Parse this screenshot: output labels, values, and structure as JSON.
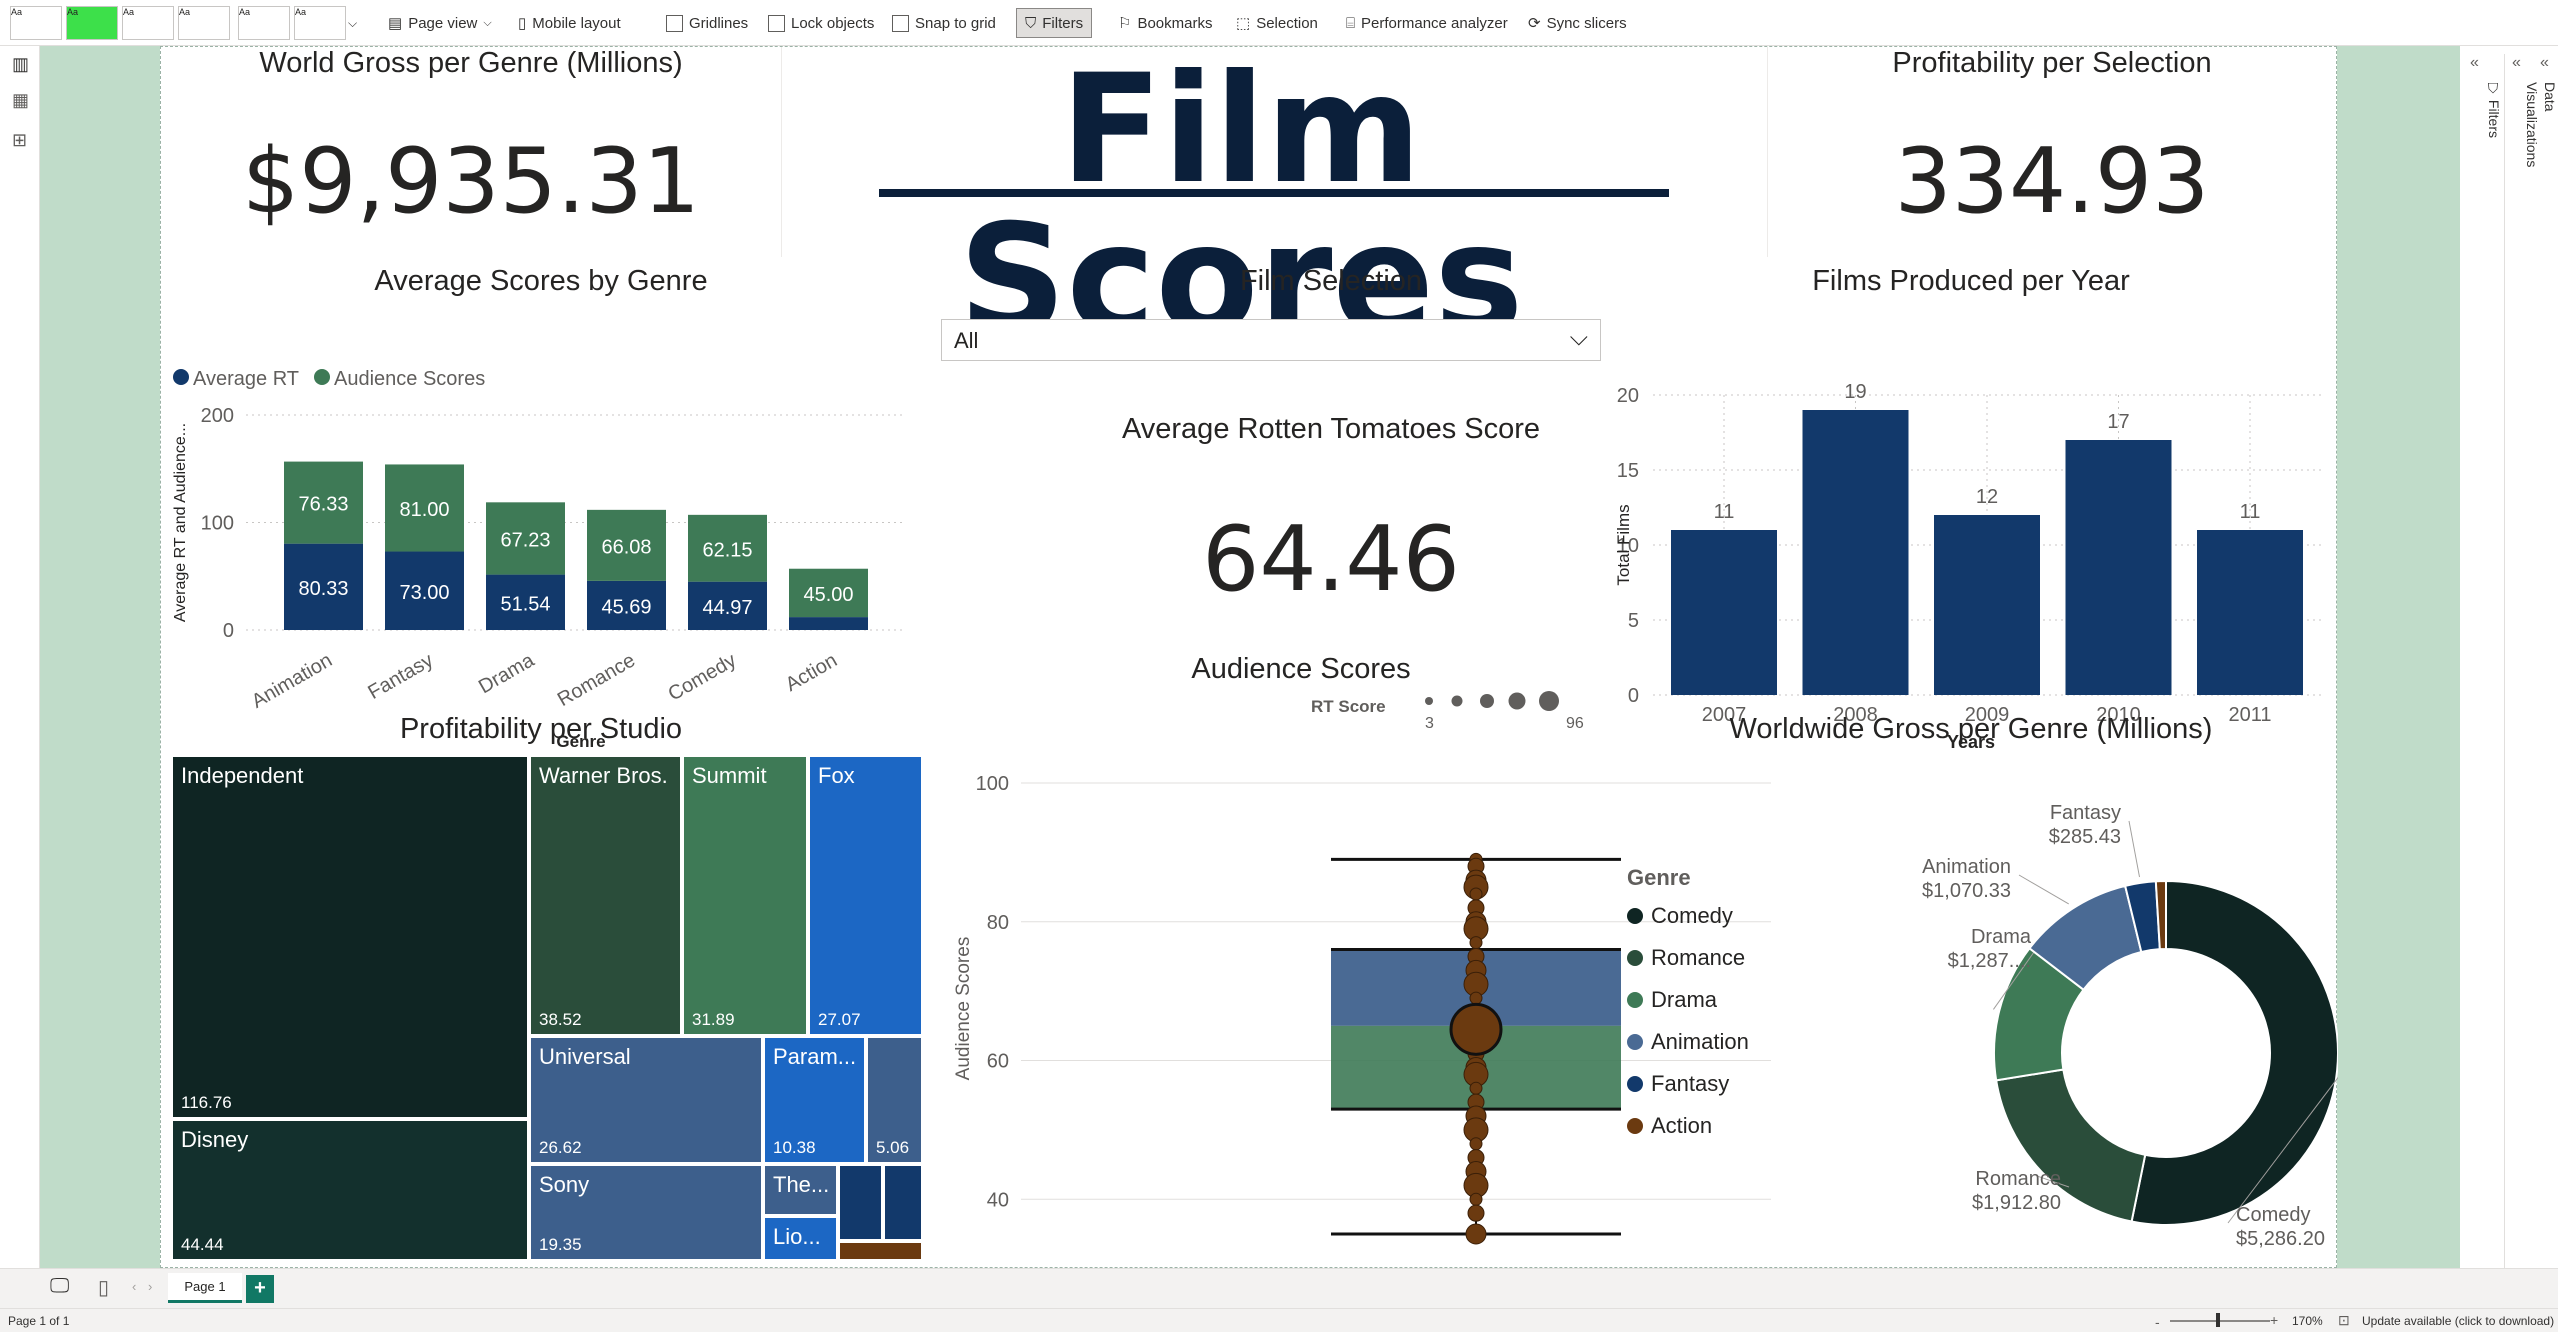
{
  "ribbon": {
    "page_view": "Page view",
    "mobile_layout": "Mobile layout",
    "gridlines": "Gridlines",
    "lock_objects": "Lock objects",
    "snap_to_grid": "Snap to grid",
    "filters": "Filters",
    "bookmarks": "Bookmarks",
    "selection": "Selection",
    "performance_analyzer": "Performance analyzer",
    "sync_slicers": "Sync slicers",
    "theme_label": "Aa"
  },
  "panes": {
    "filters": "Filters",
    "visualizations": "Visualizations",
    "data": "Data"
  },
  "report": {
    "title": "Film Scores",
    "world_gross": {
      "title": "World Gross per Genre (Millions)",
      "value": "$9,935.31"
    },
    "profitability": {
      "title": "Profitability per Selection",
      "value": "334.93"
    },
    "avg_rt": {
      "title": "Average Rotten Tomatoes Score",
      "value": "64.46"
    },
    "slicer": {
      "title": "Film Selection",
      "value": "All"
    }
  },
  "chart_data": [
    {
      "type": "bar",
      "stacked": true,
      "title": "Average Scores by Genre",
      "xlabel": "Genre",
      "ylabel": "Average RT and Audience...",
      "ylim": [
        0,
        200
      ],
      "yticks": [
        "0",
        "100",
        "200"
      ],
      "categories": [
        "Animation",
        "Fantasy",
        "Drama",
        "Romance",
        "Comedy",
        "Action"
      ],
      "series": [
        {
          "name": "Average RT",
          "color": "#12396b",
          "values": [
            80.33,
            73.0,
            51.54,
            45.69,
            44.97,
            12.0
          ],
          "labels": [
            "80.33",
            "73.00",
            "51.54",
            "45.69",
            "44.97",
            ""
          ]
        },
        {
          "name": "Audience Scores",
          "color": "#3e7a56",
          "values": [
            76.33,
            81.0,
            67.23,
            66.08,
            62.15,
            45.0
          ],
          "labels": [
            "76.33",
            "81.00",
            "67.23",
            "66.08",
            "62.15",
            "45.00"
          ]
        }
      ],
      "legend": "top-left"
    },
    {
      "type": "bar",
      "title": "Films Produced per Year",
      "xlabel": "Years",
      "ylabel": "Total Films",
      "ylim": [
        0,
        20
      ],
      "yticks": [
        "0",
        "5",
        "10",
        "15",
        "20"
      ],
      "categories": [
        "2007",
        "2008",
        "2009",
        "2010",
        "2011"
      ],
      "values": [
        11,
        19,
        12,
        17,
        11
      ],
      "color": "#12396b"
    },
    {
      "type": "table",
      "title": "Profitability per Studio",
      "cells": [
        {
          "name": "Independent",
          "value": "116.76",
          "color": "#0f2523"
        },
        {
          "name": "Disney",
          "value": "44.44",
          "color": "#13302d"
        },
        {
          "name": "Warner Bros.",
          "value": "38.52",
          "color": "#2a4d3a"
        },
        {
          "name": "Summit",
          "value": "31.89",
          "color": "#3e7a56"
        },
        {
          "name": "Fox",
          "value": "27.07",
          "color": "#1c67c4"
        },
        {
          "name": "Universal",
          "value": "26.62",
          "color": "#3d5f8c"
        },
        {
          "name": "Sony",
          "value": "19.35",
          "color": "#3d5f8c"
        },
        {
          "name": "Param...",
          "value": "10.38",
          "color": "#1c67c4"
        },
        {
          "name": "",
          "value": "5.06",
          "color": "#3d5f8c"
        },
        {
          "name": "The...",
          "value": "",
          "color": "#3d5f8c"
        },
        {
          "name": "Lio...",
          "value": "",
          "color": "#1c67c4"
        },
        {
          "name": "",
          "value": "",
          "color": "#12396b"
        },
        {
          "name": "",
          "value": "",
          "color": "#12396b"
        },
        {
          "name": "",
          "value": "",
          "color": "#6b3a10"
        }
      ]
    },
    {
      "type": "scatter",
      "title": "Audience Scores",
      "ylabel": "Audience Scores",
      "ylim": [
        35,
        100
      ],
      "yticks": [
        "40",
        "60",
        "80",
        "100"
      ],
      "size_legend": {
        "label": "RT Score",
        "min": "3",
        "max": "96"
      },
      "box": {
        "whisker_high": 89,
        "q3": 76,
        "median": 65,
        "q1": 53,
        "whisker_low": 35,
        "mean": 64.5
      },
      "points": [
        89,
        88,
        86,
        85,
        84,
        82,
        80,
        79,
        77,
        75,
        73,
        71,
        69,
        67,
        66,
        64,
        62,
        61,
        59,
        58,
        56,
        54,
        52,
        50,
        48,
        46,
        44,
        42,
        40,
        38,
        35
      ],
      "color": "#6b3a10"
    },
    {
      "type": "pie",
      "donut": true,
      "title": "Worldwide Gross per Genre (Millions)",
      "legend_title": "Genre",
      "slices": [
        {
          "name": "Comedy",
          "value": 5286.2,
          "label": "$5,286.20",
          "color": "#0f2523"
        },
        {
          "name": "Romance",
          "value": 1912.8,
          "label": "$1,912.80",
          "color": "#2a4d3a"
        },
        {
          "name": "Drama",
          "value": 1287.0,
          "label": "$1,287....",
          "color": "#3e7a56"
        },
        {
          "name": "Animation",
          "value": 1070.33,
          "label": "$1,070.33",
          "color": "#4a6a94"
        },
        {
          "name": "Fantasy",
          "value": 285.43,
          "label": "$285.43",
          "color": "#12396b"
        },
        {
          "name": "Action",
          "value": 93.55,
          "label": "",
          "color": "#6b3a10"
        }
      ],
      "legend": "left"
    }
  ],
  "bottom": {
    "page_tab": "Page 1",
    "add": "+"
  },
  "status": {
    "page_info": "Page 1 of 1",
    "zoom": "170%",
    "update": "Update available (click to download)"
  }
}
